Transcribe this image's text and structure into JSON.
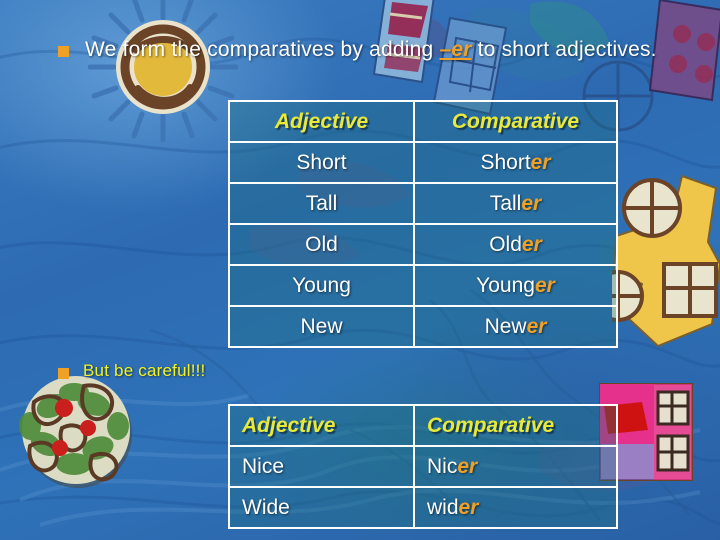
{
  "slide": {
    "bullets": [
      {
        "marker": "square-bullet",
        "text_before": "We form the comparatives by adding ",
        "emphasis": "–er",
        "text_after": " to short adjectives."
      },
      {
        "marker": "square-bullet",
        "text": "But be careful!!!"
      }
    ],
    "tables": [
      {
        "name": "comparatives",
        "headers": [
          "Adjective",
          "Comparative"
        ],
        "rows": [
          {
            "adjective": "Short",
            "stem": "Short",
            "suffix": "er"
          },
          {
            "adjective": "Tall",
            "stem": "Tall",
            "suffix": "er"
          },
          {
            "adjective": "Old",
            "stem": "Old",
            "suffix": "er"
          },
          {
            "adjective": "Young",
            "stem": "Young",
            "suffix": "er"
          },
          {
            "adjective": "New",
            "stem": "New",
            "suffix": "er"
          }
        ]
      },
      {
        "name": "exceptions",
        "headers": [
          "Adjective",
          "Comparative"
        ],
        "rows": [
          {
            "adjective": "Nice",
            "stem": "Nic",
            "suffix": "er"
          },
          {
            "adjective": "Wide",
            "stem": "wid",
            "suffix": "er"
          }
        ]
      }
    ],
    "colors": {
      "background_blue": "#2E6FB5",
      "bullet_orange": "#F0A125",
      "suffix_orange": "#F0A125",
      "header_yellow": "#E9E93A",
      "careful_yellow": "#F2F21E",
      "body_white": "#FFFFFF",
      "table_fill_teal": "#1E707C"
    },
    "decorations": [
      "sun-graphic",
      "yellow-cutout-graphic",
      "green-red-medallion-graphic",
      "pink-cutout-graphic",
      "banner-kite-graphics"
    ]
  }
}
